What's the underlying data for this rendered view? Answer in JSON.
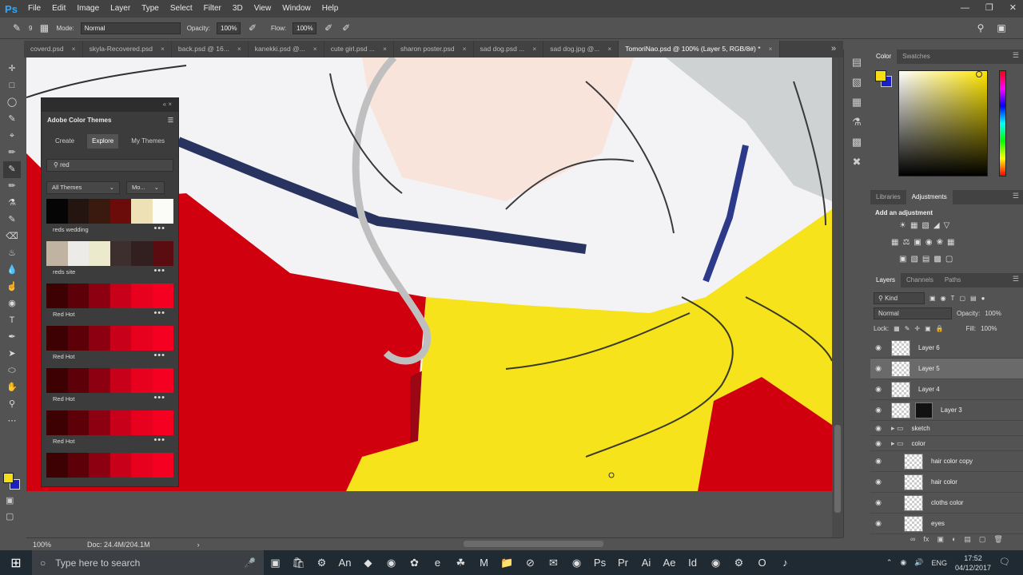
{
  "app": {
    "logo": "Ps"
  },
  "menu": [
    "File",
    "Edit",
    "Image",
    "Layer",
    "Type",
    "Select",
    "Filter",
    "3D",
    "View",
    "Window",
    "Help"
  ],
  "options": {
    "mode_label": "Mode:",
    "mode_value": "Normal",
    "opacity_label": "Opacity:",
    "opacity_value": "100%",
    "flow_label": "Flow:",
    "flow_value": "100%",
    "brush_size": "9"
  },
  "tabs": [
    {
      "label": "coverd.psd"
    },
    {
      "label": "skyla-Recovered.psd"
    },
    {
      "label": "back.psd @ 16..."
    },
    {
      "label": "kanekki.psd @..."
    },
    {
      "label": "cute girl.psd ..."
    },
    {
      "label": "sharon poster.psd"
    },
    {
      "label": "sad dog.psd ..."
    },
    {
      "label": "sad dog.jpg @..."
    },
    {
      "label": "TomoriNao.psd @ 100% (Layer 5, RGB/8#) *",
      "active": true
    }
  ],
  "status": {
    "zoom": "100%",
    "doc": "Doc: 24.4M/204.1M"
  },
  "color_themes": {
    "title": "Adobe Color Themes",
    "tabs": [
      "Create",
      "Explore",
      "My Themes"
    ],
    "search": "red",
    "filter_all": "All Themes",
    "filter_sort": "Mo...",
    "themes": [
      {
        "name": "reds wedding",
        "colors": [
          "#050505",
          "#241510",
          "#3a1a0f",
          "#6b0b0a",
          "#efe1b6",
          "#fbfbf7"
        ]
      },
      {
        "name": "reds site",
        "colors": [
          "#c0b3a2",
          "#ecebe8",
          "#eceacd",
          "#3c2f2d",
          "#31201f",
          "#5b0c10"
        ]
      },
      {
        "name": "Red Hot",
        "colors": [
          "#3d0003",
          "#5e0007",
          "#8c0011",
          "#c8001a",
          "#e8001f",
          "#f50021"
        ]
      },
      {
        "name": "Red Hot",
        "colors": [
          "#3d0003",
          "#5e0007",
          "#8c0011",
          "#c8001a",
          "#e8001f",
          "#f50021"
        ]
      },
      {
        "name": "Red Hot",
        "colors": [
          "#3d0003",
          "#5e0007",
          "#8c0011",
          "#c8001a",
          "#e8001f",
          "#f50021"
        ]
      },
      {
        "name": "Red Hot",
        "colors": [
          "#3d0003",
          "#5e0007",
          "#8c0011",
          "#c8001a",
          "#e8001f",
          "#f50021"
        ]
      },
      {
        "name": "",
        "colors": [
          "#3d0003",
          "#5e0007",
          "#8c0011",
          "#c8001a",
          "#e8001f",
          "#f50021"
        ]
      }
    ]
  },
  "panels": {
    "color_tabs": [
      "Color",
      "Swatches"
    ],
    "adj_tabs": [
      "Libraries",
      "Adjustments"
    ],
    "adj_title": "Add an adjustment",
    "layer_tabs": [
      "Layers",
      "Channels",
      "Paths"
    ],
    "kind": "Kind",
    "blend": "Normal",
    "opacity_label": "Opacity:",
    "opacity_value": "100%",
    "lock_label": "Lock:",
    "fill_label": "Fill:",
    "fill_value": "100%"
  },
  "layers": [
    {
      "name": "Layer 6"
    },
    {
      "name": "Layer 5",
      "selected": true
    },
    {
      "name": "Layer 4"
    },
    {
      "name": "Layer 3"
    },
    {
      "name": "sketch",
      "group": true
    },
    {
      "name": "color",
      "group": true
    },
    {
      "name": "hair color copy"
    },
    {
      "name": "hair color"
    },
    {
      "name": "cloths color"
    },
    {
      "name": "eyes"
    }
  ],
  "taskbar": {
    "search": "Type here to search",
    "lang": "ENG",
    "time": "17:52",
    "date": "04/12/2017"
  },
  "colors": {
    "fg": "#f5df14",
    "bg": "#1a1fc8"
  }
}
